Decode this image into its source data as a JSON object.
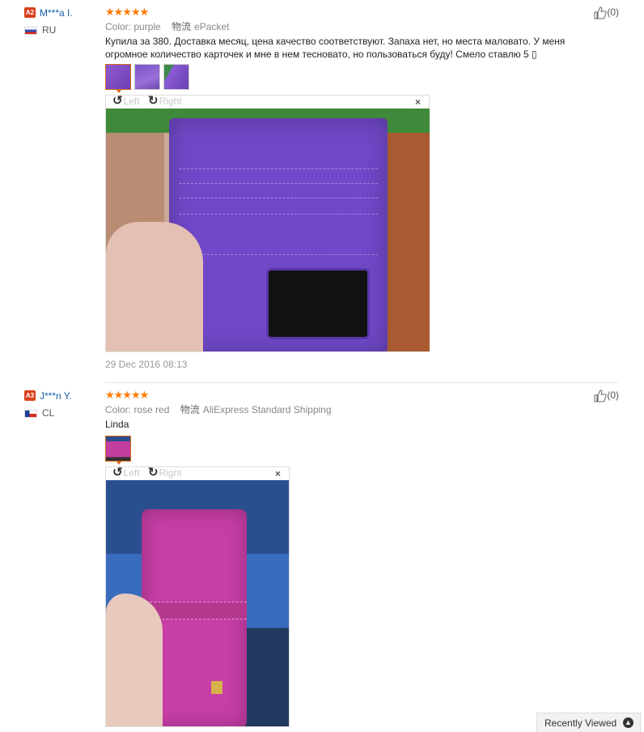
{
  "reviews": [
    {
      "level": "A2",
      "user": "M***a I.",
      "country": "RU",
      "stars": "★★★★★",
      "color_key": "Color:",
      "color_value": "purple",
      "shipping_key": "物流",
      "shipping_value": "ePacket",
      "text": "Купила за 380. Доставка месяц, цена качество соответствуют. Запаха нет, но места маловато. У меня огромное количество карточек и мне в нем тесновато, но пользоваться буду! Смело ставлю 5 ▯",
      "rotate_left": "Left",
      "rotate_right": "Right",
      "close": "×",
      "date": "29 Dec 2016 08:13",
      "helpful": "(0)"
    },
    {
      "level": "A3",
      "user": "J***n Y.",
      "country": "CL",
      "stars": "★★★★★",
      "color_key": "Color:",
      "color_value": "rose red",
      "shipping_key": "物流",
      "shipping_value": "AliExpress Standard Shipping",
      "text": "Linda",
      "rotate_left": "Left",
      "rotate_right": "Right",
      "close": "×",
      "helpful": "(0)"
    }
  ],
  "recently_viewed": "Recently Viewed",
  "colors": {
    "star": "#ff7a00",
    "link": "#1a5fa8",
    "level_badge": "#d9401c",
    "active_thumb": "#d96a1d"
  },
  "icons": [
    "thumbs-up-icon",
    "rotate-left-icon",
    "rotate-right-icon",
    "close-icon",
    "chevron-up-icon",
    "flag-icon"
  ]
}
